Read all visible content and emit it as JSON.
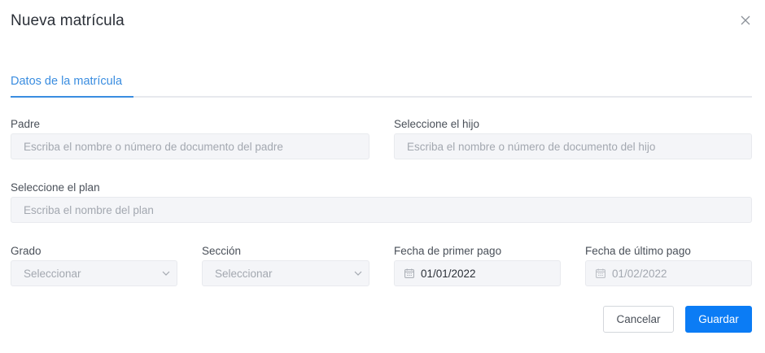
{
  "modal": {
    "title": "Nueva matrícula"
  },
  "tabs": [
    {
      "label": "Datos de la matrícula",
      "active": true
    }
  ],
  "form": {
    "padre": {
      "label": "Padre",
      "placeholder": "Escriba el nombre o número de documento del padre"
    },
    "hijo": {
      "label": "Seleccione el hijo",
      "placeholder": "Escriba el nombre o número de documento del hijo"
    },
    "plan": {
      "label": "Seleccione el plan",
      "placeholder": "Escriba el nombre del plan"
    },
    "grado": {
      "label": "Grado",
      "placeholder": "Seleccionar"
    },
    "seccion": {
      "label": "Sección",
      "placeholder": "Seleccionar"
    },
    "fecha_primer_pago": {
      "label": "Fecha de primer pago",
      "value": "01/01/2022"
    },
    "fecha_ultimo_pago": {
      "label": "Fecha de último pago",
      "value": "01/02/2022"
    }
  },
  "actions": {
    "cancel_label": "Cancelar",
    "save_label": "Guardar"
  },
  "icons": {
    "close": "close-icon",
    "chevron": "chevron-down-icon",
    "calendar": "calendar-icon"
  },
  "colors": {
    "accent": "#3a8de0",
    "primary_button": "#0b7cf5",
    "input_bg": "#f4f5f8"
  }
}
